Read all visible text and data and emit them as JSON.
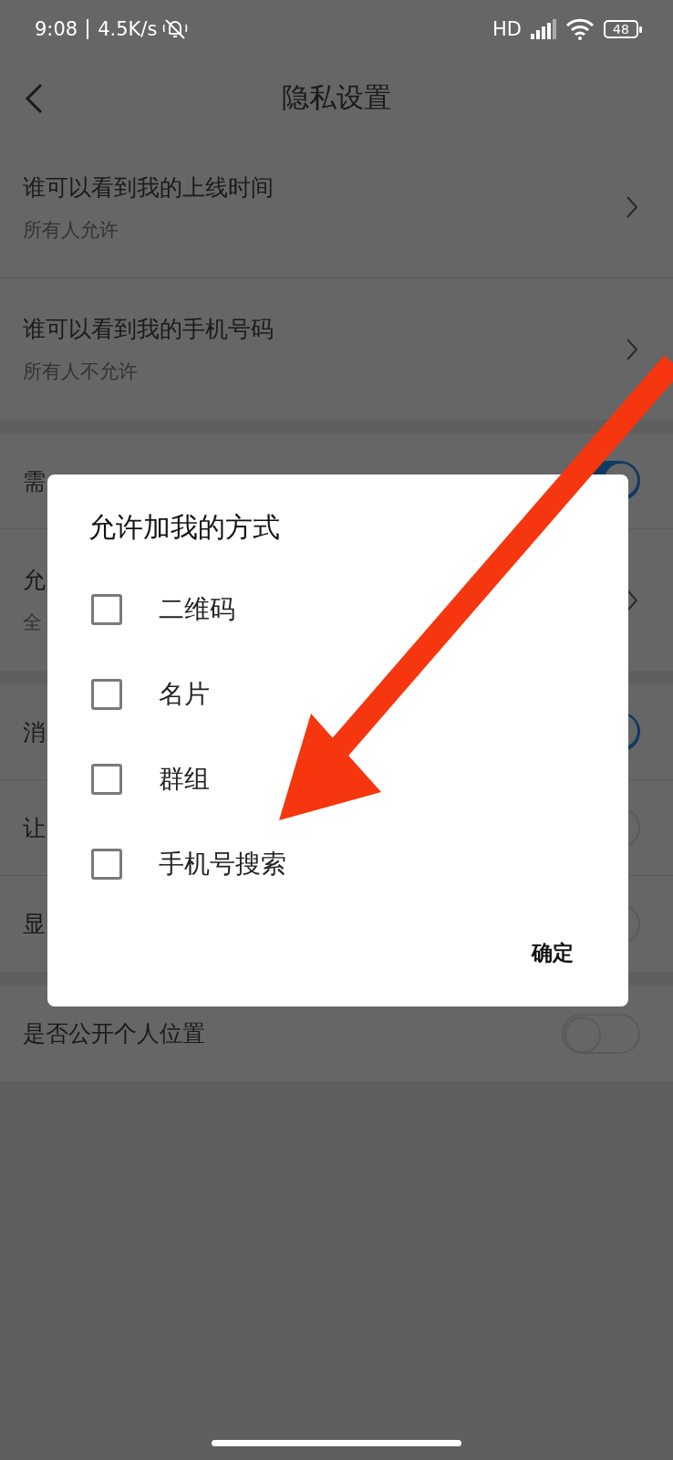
{
  "status_bar": {
    "time": "9:08",
    "speed": "4.5K/s",
    "network": "HD",
    "battery": "48"
  },
  "header": {
    "title": "隐私设置"
  },
  "sections": [
    {
      "rows": [
        {
          "kind": "link",
          "title": "谁可以看到我的上线时间",
          "subtitle": "所有人允许"
        },
        {
          "kind": "link",
          "title": "谁可以看到我的手机号码",
          "subtitle": "所有人不允许"
        }
      ]
    },
    {
      "rows": [
        {
          "kind": "toggle",
          "title": "需",
          "on": true
        },
        {
          "kind": "link",
          "title": "允",
          "subtitle": "全"
        }
      ]
    },
    {
      "rows": [
        {
          "kind": "toggle",
          "title": "消",
          "on": true
        },
        {
          "kind": "toggle",
          "title": "让",
          "on": false
        },
        {
          "kind": "toggle",
          "title": "显",
          "on": false
        }
      ]
    },
    {
      "rows": [
        {
          "kind": "toggle",
          "title": "是否公开个人位置",
          "on": false
        }
      ]
    }
  ],
  "dialog": {
    "title": "允许加我的方式",
    "options": [
      {
        "label": "二维码",
        "checked": false
      },
      {
        "label": "名片",
        "checked": false
      },
      {
        "label": "群组",
        "checked": false
      },
      {
        "label": "手机号搜索",
        "checked": false
      }
    ],
    "confirm": "确定"
  }
}
